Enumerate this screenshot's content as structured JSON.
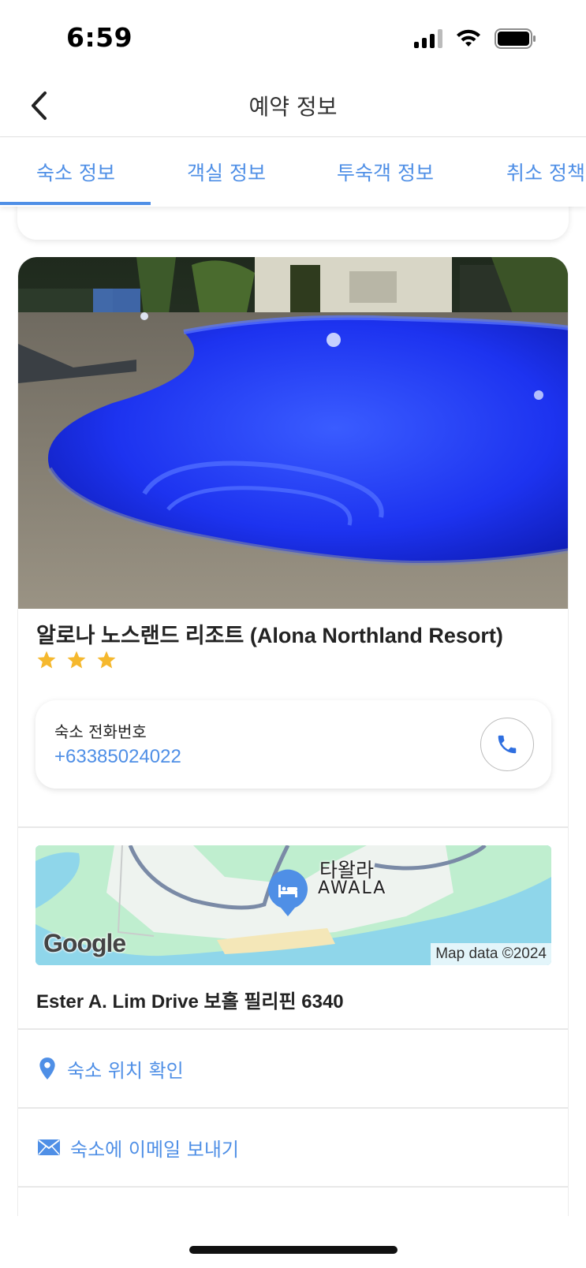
{
  "status_bar": {
    "time": "6:59"
  },
  "nav": {
    "title": "예약 정보"
  },
  "tabs": [
    {
      "label": "숙소 정보",
      "active": true
    },
    {
      "label": "객실 정보",
      "active": false
    },
    {
      "label": "투숙객 정보",
      "active": false
    },
    {
      "label": "취소 정책",
      "active": false
    }
  ],
  "hotel": {
    "name": "알로나 노스랜드 리조트 (Alona Northland Resort)",
    "star_rating": 3,
    "phone_label": "숙소 전화번호",
    "phone_number": "+63385024022"
  },
  "map": {
    "place_label_ko": "타왈라",
    "place_label_en": "AWALA",
    "provider": "Google",
    "attribution": "Map data ©2024"
  },
  "address": "Ester A. Lim Drive 보홀 필리핀 6340",
  "actions": {
    "view_location": "숙소 위치 확인",
    "send_email": "숙소에 이메일 보내기"
  },
  "colors": {
    "accent": "#4f8fe6",
    "star": "#f5b82e",
    "pool": "#1c3dff"
  },
  "icons": [
    "back-chevron-icon",
    "signal-icon",
    "wifi-icon",
    "battery-icon",
    "star-icon",
    "phone-icon",
    "hotel-bed-icon",
    "location-pin-icon",
    "mail-icon"
  ]
}
